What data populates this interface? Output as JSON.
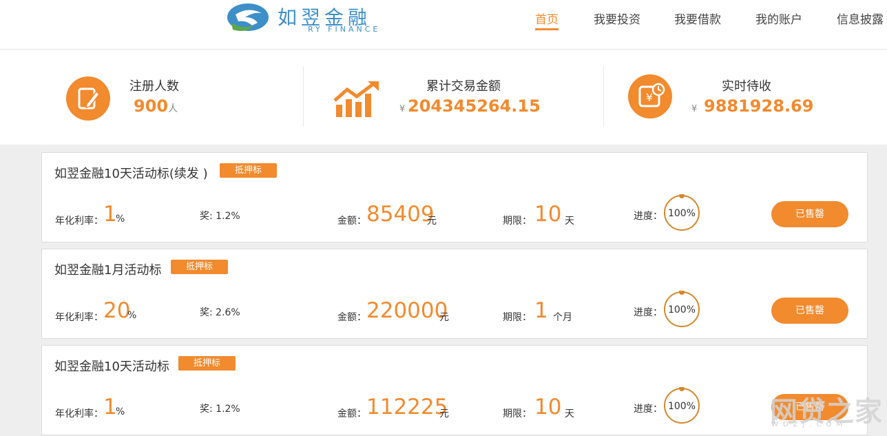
{
  "header": {
    "logo": {
      "name_cn": "如翌金融",
      "name_en": "RY FINANCE",
      "colors": {
        "blue": "#3d8fc8",
        "green": "#5ba84a"
      }
    },
    "nav": [
      {
        "label": "首页",
        "active": true
      },
      {
        "label": "我要投资",
        "active": false
      },
      {
        "label": "我要借款",
        "active": false
      },
      {
        "label": "我的账户",
        "active": false
      },
      {
        "label": "信息披露",
        "active": false
      }
    ]
  },
  "stats": [
    {
      "icon": "edit-icon",
      "label": "注册人数",
      "value": "900",
      "unit": "人"
    },
    {
      "icon": "growth-chart-icon",
      "label": "累计交易金额",
      "currency": "¥",
      "value": "204345264.15"
    },
    {
      "icon": "yen-clock-icon",
      "label": "实时待收",
      "currency": "¥",
      "value": "9881928.69"
    }
  ],
  "loans": [
    {
      "title": "如翌金融10天活动标(续发 )",
      "tag": "抵押标",
      "rate_label": "年化利率：",
      "rate_value": "1",
      "rate_unit": "%",
      "bonus_label": "奖: 1.2%",
      "amount_label": "金额：",
      "amount_value": "85409",
      "amount_unit": "元",
      "term_label": "期限：",
      "term_value": "10",
      "term_unit": "天",
      "progress_label": "进度：",
      "progress_text": "100%",
      "progress": 1.0,
      "button": "已售罄"
    },
    {
      "title": "如翌金融1月活动标",
      "tag": "抵押标",
      "rate_label": "年化利率：",
      "rate_value": "20",
      "rate_unit": "%",
      "bonus_label": "奖: 2.6%",
      "amount_label": "金额：",
      "amount_value": "220000",
      "amount_unit": "元",
      "term_label": "期限：",
      "term_value": "1",
      "term_unit": "个月",
      "progress_label": "进度：",
      "progress_text": "100%",
      "progress": 1.0,
      "button": "已售罄"
    },
    {
      "title": "如翌金融10天活动标",
      "tag": "抵押标",
      "rate_label": "年化利率：",
      "rate_value": "1",
      "rate_unit": "%",
      "bonus_label": "奖: 1.2%",
      "amount_label": "金额：",
      "amount_value": "112225",
      "amount_unit": "元",
      "term_label": "期限：",
      "term_value": "10",
      "term_unit": "天",
      "progress_label": "进度：",
      "progress_text": "100%",
      "progress": 1.0,
      "button": "已售罄"
    }
  ],
  "watermark": {
    "text": "网贷之家",
    "sub": "WDZJ.COM"
  },
  "colors": {
    "accent": "#f28a2e",
    "ring": "#d4882a"
  }
}
